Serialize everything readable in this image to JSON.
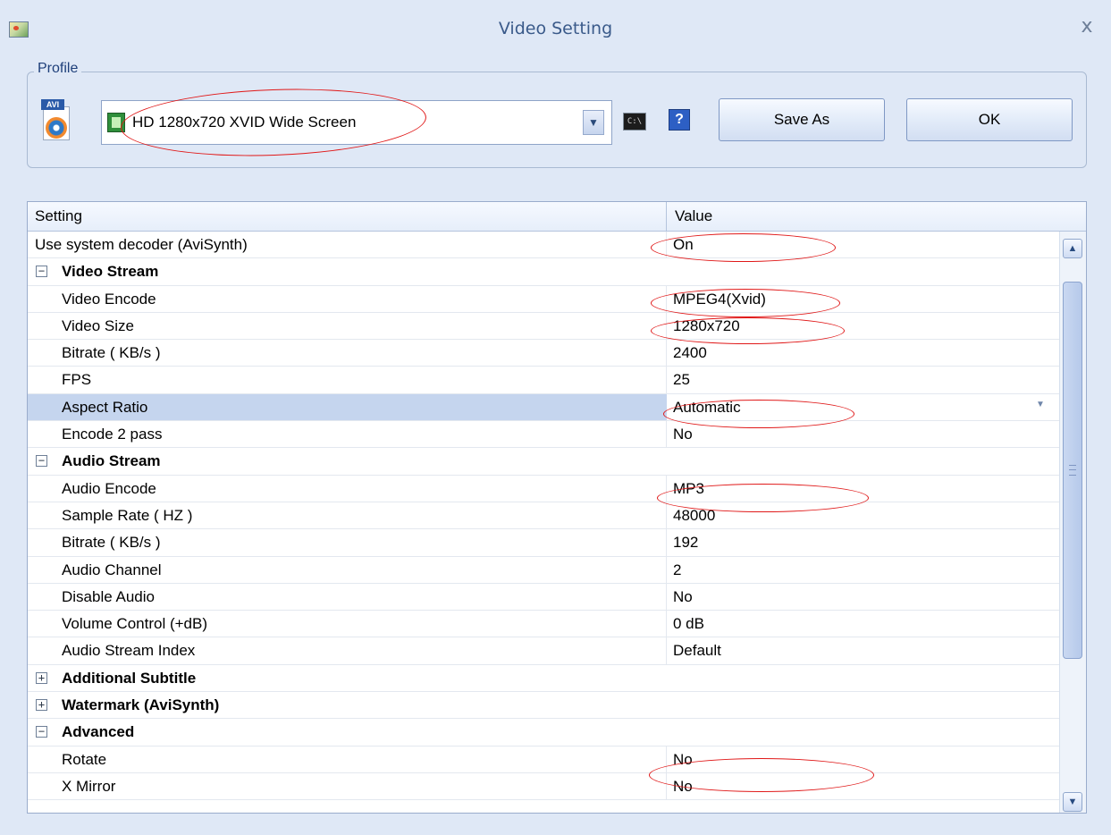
{
  "window": {
    "title": "Video Setting",
    "close_glyph": "x"
  },
  "profile": {
    "legend": "Profile",
    "selected": "HD 1280x720 XVID Wide Screen",
    "save_as_label": "Save As",
    "ok_label": "OK",
    "avi_tag": "AVI",
    "cmd_label": "C:\\",
    "help_label": "?"
  },
  "grid": {
    "headers": {
      "setting": "Setting",
      "value": "Value"
    },
    "rows": [
      {
        "name": "Use system decoder (AviSynth)",
        "value": "On",
        "type": "item"
      },
      {
        "name": "Video Stream",
        "type": "category",
        "expander": "−"
      },
      {
        "name": "Video Encode",
        "value": "MPEG4(Xvid)",
        "type": "child"
      },
      {
        "name": "Video Size",
        "value": "1280x720",
        "type": "child"
      },
      {
        "name": "Bitrate ( KB/s )",
        "value": "2400",
        "type": "child"
      },
      {
        "name": "FPS",
        "value": "25",
        "type": "child"
      },
      {
        "name": "Aspect Ratio",
        "value": "Automatic",
        "type": "child",
        "selected": true
      },
      {
        "name": "Encode 2 pass",
        "value": "No",
        "type": "child"
      },
      {
        "name": "Audio Stream",
        "type": "category",
        "expander": "−"
      },
      {
        "name": "Audio Encode",
        "value": "MP3",
        "type": "child"
      },
      {
        "name": "Sample Rate ( HZ )",
        "value": "48000",
        "type": "child"
      },
      {
        "name": "Bitrate ( KB/s )",
        "value": "192",
        "type": "child"
      },
      {
        "name": "Audio Channel",
        "value": "2",
        "type": "child"
      },
      {
        "name": "Disable Audio",
        "value": "No",
        "type": "child"
      },
      {
        "name": "Volume Control (+dB)",
        "value": "0 dB",
        "type": "child"
      },
      {
        "name": "Audio Stream Index",
        "value": "Default",
        "type": "child"
      },
      {
        "name": "Additional Subtitle",
        "type": "category",
        "expander": "+"
      },
      {
        "name": "Watermark (AviSynth)",
        "type": "category",
        "expander": "+"
      },
      {
        "name": "Advanced",
        "type": "category",
        "expander": "−"
      },
      {
        "name": "Rotate",
        "value": "No",
        "type": "child"
      },
      {
        "name": "X Mirror",
        "value": "No",
        "type": "child"
      }
    ]
  },
  "colors": {
    "background": "#dfe8f6",
    "selection": "#c5d5ee",
    "annotation": "#e01818"
  }
}
